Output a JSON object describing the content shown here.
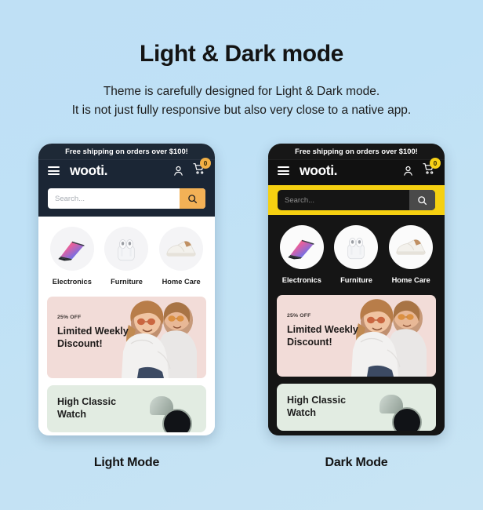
{
  "header": {
    "title": "Light & Dark mode",
    "subtitle_line1": "Theme is carefully designed for Light & Dark mode.",
    "subtitle_line2": "It is not just fully responsive but also very close to a native app."
  },
  "colors": {
    "page_background_start": "#bfe0f5",
    "page_background_end": "#c8e4f4",
    "light_navbar": "#1b2635",
    "dark_navbar": "#111111",
    "light_search_button": "#f3b156",
    "dark_search_band": "#f5d011",
    "light_cart_badge": "#f2b045",
    "dark_cart_badge": "#f7d117",
    "banner_background": "#f2dcd8",
    "product_card_background": "#e2ece2"
  },
  "light_mode": {
    "caption": "Light Mode",
    "promo_strip": "Free shipping on orders over $100!",
    "brand": "wooti.",
    "cart_count": "0",
    "search_placeholder": "Search...",
    "categories": [
      {
        "label": "Electronics",
        "icon": "tablet-icon"
      },
      {
        "label": "Furniture",
        "icon": "earbuds-icon"
      },
      {
        "label": "Home Care",
        "icon": "shoe-icon"
      }
    ],
    "banner": {
      "discount": "25% OFF",
      "title_line1": "Limited Weekly",
      "title_line2": "Discount!"
    },
    "product": {
      "title_line1": "High Classic",
      "title_line2": "Watch"
    }
  },
  "dark_mode": {
    "caption": "Dark Mode",
    "promo_strip": "Free shipping on orders over $100!",
    "brand": "wooti.",
    "cart_count": "0",
    "search_placeholder": "Search...",
    "categories": [
      {
        "label": "Electronics",
        "icon": "tablet-icon"
      },
      {
        "label": "Furniture",
        "icon": "earbuds-icon"
      },
      {
        "label": "Home Care",
        "icon": "shoe-icon"
      }
    ],
    "banner": {
      "discount": "25% OFF",
      "title_line1": "Limited Weekly",
      "title_line2": "Discount!"
    },
    "product": {
      "title_line1": "High Classic",
      "title_line2": "Watch"
    }
  }
}
